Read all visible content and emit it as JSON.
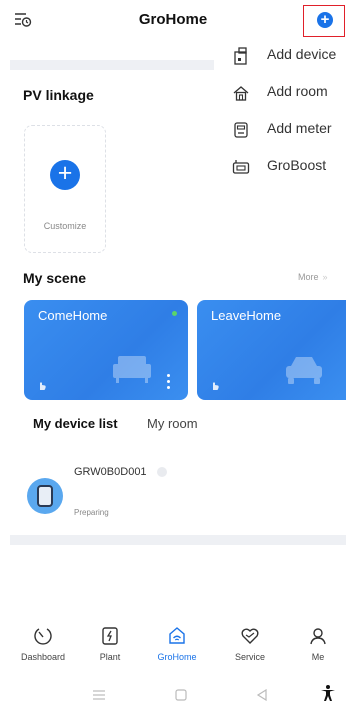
{
  "header": {
    "title": "GroHome",
    "menu_icon": "history-icon",
    "add_icon": "plus-circle-icon"
  },
  "add_menu": [
    {
      "label": "Add device",
      "icon": "device-icon"
    },
    {
      "label": "Add room",
      "icon": "home-icon"
    },
    {
      "label": "Add meter",
      "icon": "meter-icon"
    },
    {
      "label": "GroBoost",
      "icon": "groboost-icon"
    }
  ],
  "pv_linkage": {
    "title": "PV linkage",
    "customize_label": "Customize"
  },
  "my_scene": {
    "title": "My scene",
    "more_label": "More",
    "more_chevron": "»",
    "scenes": [
      {
        "name": "ComeHome",
        "decor_icon": "sofa-icon"
      },
      {
        "name": "LeaveHome",
        "decor_icon": "car-icon"
      }
    ]
  },
  "device_tabs": [
    {
      "label": "My device list",
      "active": true
    },
    {
      "label": "My room",
      "active": false
    }
  ],
  "devices": [
    {
      "name": "GRW0B0D001",
      "status": "Preparing",
      "icon": "wallbox-icon"
    }
  ],
  "bottom_nav": [
    {
      "label": "Dashboard",
      "icon": "dashboard-icon",
      "active": false
    },
    {
      "label": "Plant",
      "icon": "plant-icon",
      "active": false
    },
    {
      "label": "GroHome",
      "icon": "grohome-icon",
      "active": true
    },
    {
      "label": "Service",
      "icon": "service-icon",
      "active": false
    },
    {
      "label": "Me",
      "icon": "person-icon",
      "active": false
    }
  ],
  "colors": {
    "accent": "#1a73e8",
    "highlight_border": "#e0202a",
    "scene_card": "#2f7ee6"
  }
}
